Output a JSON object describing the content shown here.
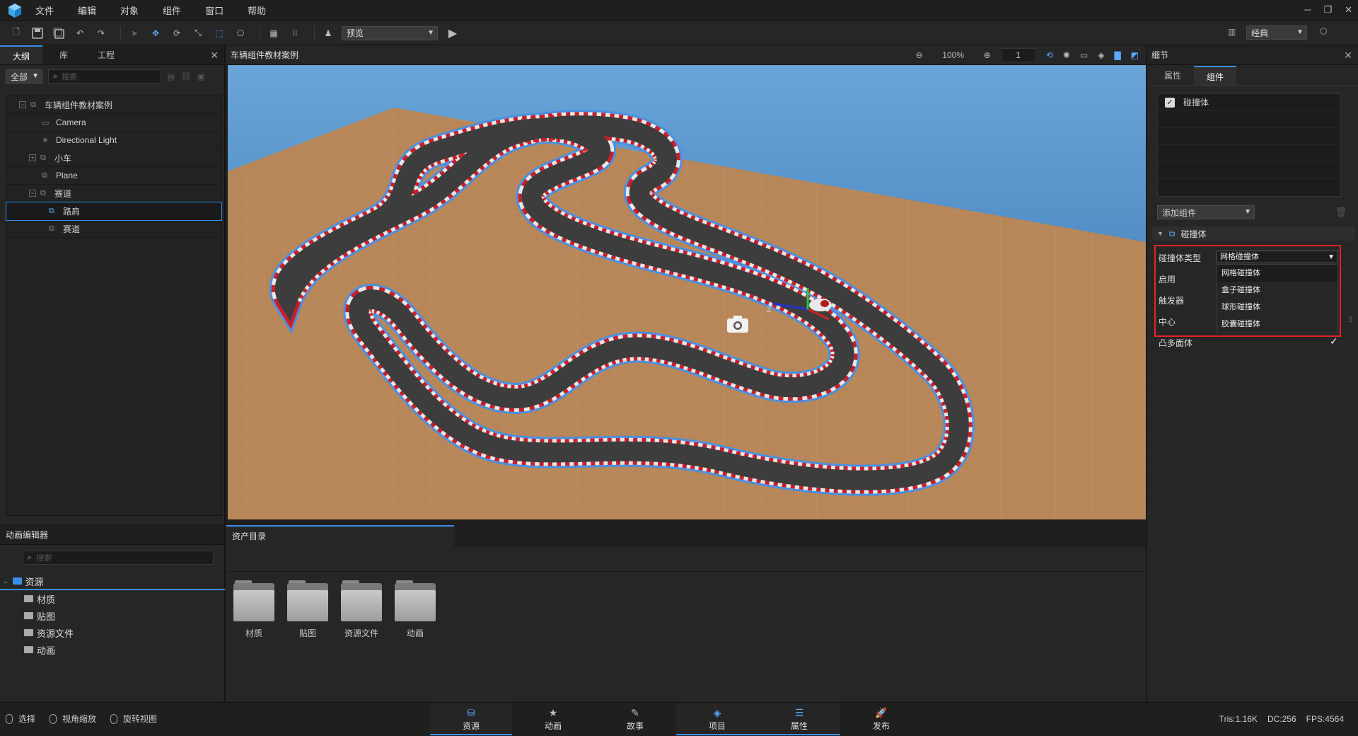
{
  "menu": [
    "文件",
    "编辑",
    "对象",
    "组件",
    "窗口",
    "帮助"
  ],
  "toolbar": {
    "preview_select": "预览",
    "layout_select": "经典"
  },
  "outline": {
    "tabs": [
      "大纲",
      "库",
      "工程"
    ],
    "filter": "全部",
    "search_placeholder": "搜索",
    "items": [
      {
        "label": "车辆组件教材案例",
        "icon": "prefab-icon"
      },
      {
        "label": "Camera",
        "icon": "camera-icon"
      },
      {
        "label": "Directional Light",
        "icon": "light-icon"
      },
      {
        "label": "小车",
        "icon": "prefab-icon"
      },
      {
        "label": "Plane",
        "icon": "prefab-icon"
      },
      {
        "label": "赛道",
        "icon": "prefab-icon"
      },
      {
        "label": "路肩",
        "icon": "prefab-icon"
      },
      {
        "label": "赛道",
        "icon": "prefab-icon"
      }
    ]
  },
  "viewport": {
    "title": "车辆组件教材案例",
    "zoom": "100%",
    "frame": "1"
  },
  "details": {
    "header": "细节",
    "tabs": [
      "属性",
      "组件"
    ],
    "components": [
      {
        "label": "碰撞体",
        "checked": true
      }
    ],
    "add_component": "添加组件",
    "section": "碰撞体",
    "props": {
      "collider_type_label": "碰撞体类型",
      "collider_type_value": "网格碰撞体",
      "enabled_label": "启用",
      "trigger_label": "触发器",
      "center_label": "中心",
      "convex_label": "凸多面体"
    },
    "dropdown_options": [
      "网格碰撞体",
      "盒子碰撞体",
      "球形碰撞体",
      "胶囊碰撞体"
    ]
  },
  "anim_editor": {
    "title": "动画编辑器",
    "search_placeholder": "搜索",
    "root": "资源",
    "children": [
      "材质",
      "贴图",
      "资源文件",
      "动画"
    ]
  },
  "assets": {
    "tab": "资产目录",
    "folders": [
      "材质",
      "贴图",
      "资源文件",
      "动画"
    ]
  },
  "status": {
    "left": [
      "选择",
      "视角缩放",
      "旋转视图"
    ],
    "tabs": [
      {
        "label": "资源",
        "icon": "resource-icon",
        "active": true
      },
      {
        "label": "动画",
        "icon": "animation-icon",
        "active": false
      },
      {
        "label": "故事",
        "icon": "story-icon",
        "active": false
      },
      {
        "label": "项目",
        "icon": "project-icon",
        "active": true
      },
      {
        "label": "属性",
        "icon": "properties-icon",
        "active": true
      },
      {
        "label": "发布",
        "icon": "publish-icon",
        "active": false
      }
    ],
    "tris": "Tris:1.16K",
    "dc": "DC:256",
    "fps": "FPS:4564"
  },
  "colors": {
    "accent": "#3b8fe8",
    "highlight_border": "#e52222",
    "ground": "#b98a5c",
    "track": "#3c3c3c"
  }
}
